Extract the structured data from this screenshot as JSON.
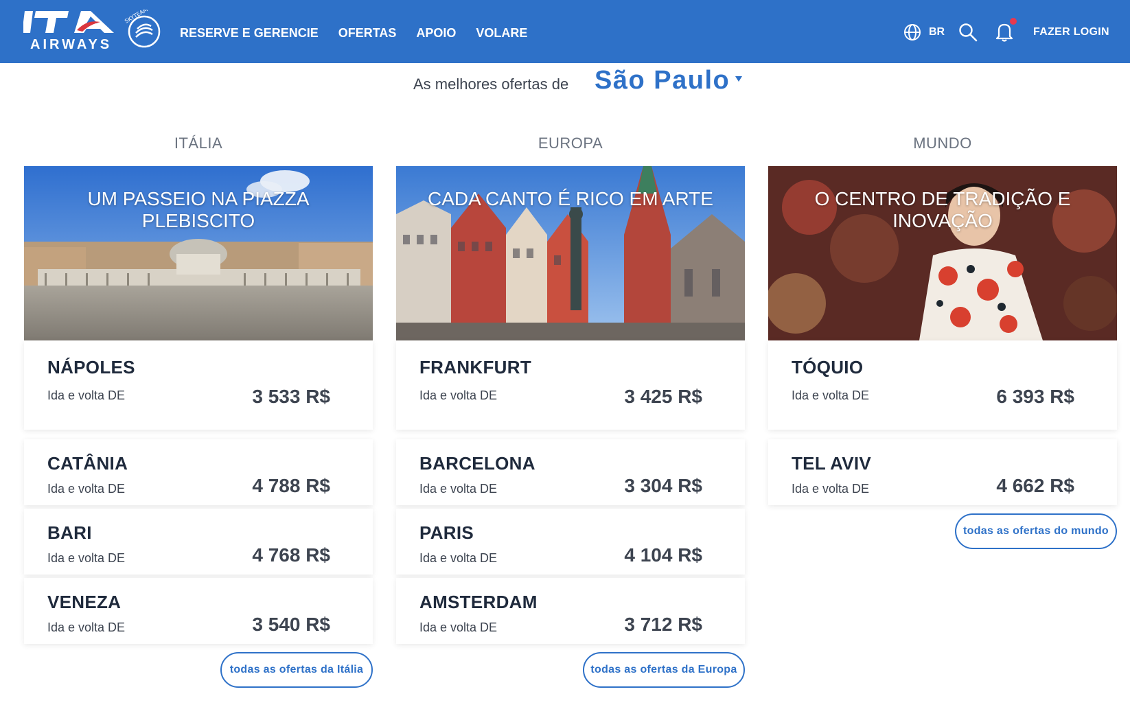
{
  "header": {
    "logo_main": "ITA",
    "logo_sub": "AIRWAYS",
    "logo_partner": "SKYTEAM",
    "nav": [
      "RESERVE E GERENCIE",
      "OFERTAS",
      "APOIO",
      "VOLARE"
    ],
    "language": "BR",
    "login_label": "FAZER LOGIN"
  },
  "selector": {
    "label": "As melhores ofertas de",
    "city": "São Paulo"
  },
  "columns": [
    {
      "title": "ITÁLIA",
      "hero_caption": "UM PASSEIO NA PIAZZA PLEBISCITO",
      "offers": [
        {
          "city": "NÁPOLES",
          "sub": "Ida e volta DE",
          "price": "3 533 R$"
        },
        {
          "city": "CATÂNIA",
          "sub": "Ida e volta DE",
          "price": "4 788 R$"
        },
        {
          "city": "BARI",
          "sub": "Ida e volta DE",
          "price": "4 768 R$"
        },
        {
          "city": "VENEZA",
          "sub": "Ida e volta DE",
          "price": "3 540 R$"
        }
      ],
      "more_label": "todas as ofertas da Itália"
    },
    {
      "title": "EUROPA",
      "hero_caption": "CADA CANTO É RICO EM ARTE",
      "offers": [
        {
          "city": "FRANKFURT",
          "sub": "Ida e volta DE",
          "price": "3 425 R$"
        },
        {
          "city": "BARCELONA",
          "sub": "Ida e volta DE",
          "price": "3 304 R$"
        },
        {
          "city": "PARIS",
          "sub": "Ida e volta DE",
          "price": "4 104 R$"
        },
        {
          "city": "AMSTERDAM",
          "sub": "Ida e volta DE",
          "price": "3 712 R$"
        }
      ],
      "more_label": "todas as ofertas da Europa"
    },
    {
      "title": "MUNDO",
      "hero_caption": "O CENTRO DE TRADIÇÃO E INOVAÇÃO",
      "offers": [
        {
          "city": "TÓQUIO",
          "sub": "Ida e volta DE",
          "price": "6 393 R$"
        },
        {
          "city": "TEL AVIV",
          "sub": "Ida e volta DE",
          "price": "4 662 R$"
        }
      ],
      "more_label": "todas as ofertas do mundo"
    }
  ],
  "colors": {
    "brand_blue": "#2e71c8",
    "notification_dot": "#e8384f"
  },
  "icons": [
    "globe-icon",
    "search-icon",
    "bell-icon",
    "dropdown-arrow-icon"
  ]
}
